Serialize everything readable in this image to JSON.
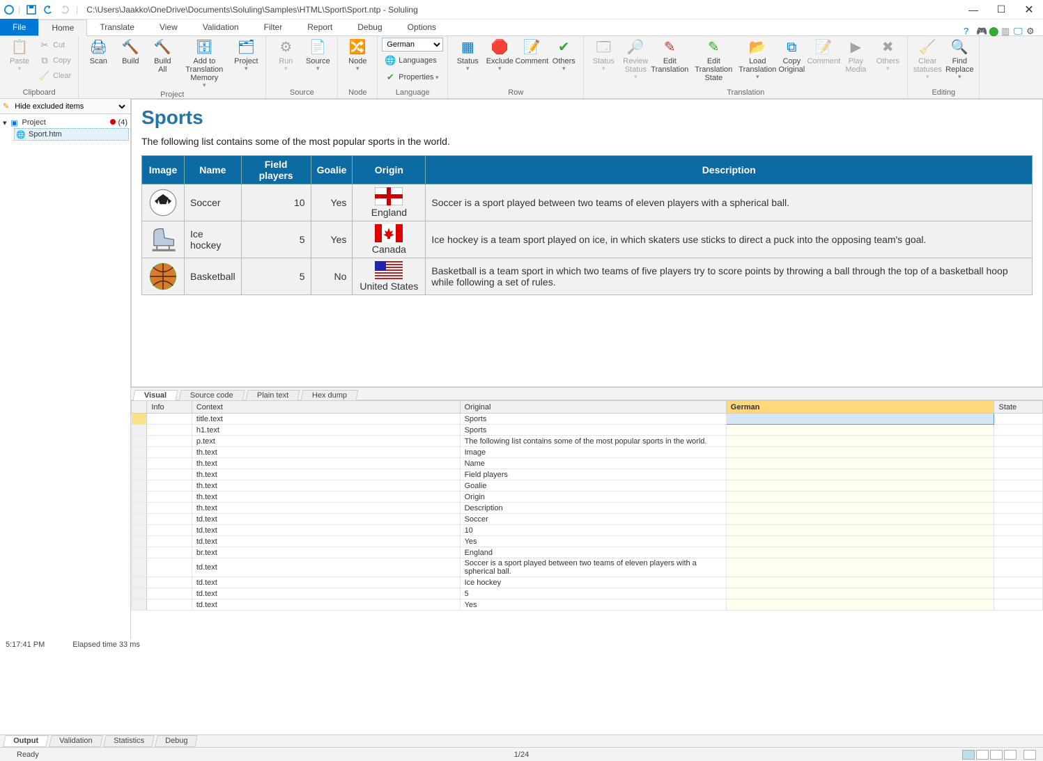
{
  "app": {
    "title_path": "C:\\Users\\Jaakko\\OneDrive\\Documents\\Soluling\\Samples\\HTML\\Sport\\Sport.ntp  -  Soluling"
  },
  "menutabs": {
    "file": "File",
    "items": [
      "Home",
      "Translate",
      "View",
      "Validation",
      "Filter",
      "Report",
      "Debug",
      "Options"
    ]
  },
  "ribbon": {
    "clipboard": {
      "title": "Clipboard",
      "paste": "Paste",
      "cut": "Cut",
      "copy": "Copy",
      "clear": "Clear"
    },
    "project": {
      "title": "Project",
      "scan": "Scan",
      "build": "Build",
      "buildall": "Build\nAll",
      "atm": "Add to Translation\nMemory",
      "project": "Project"
    },
    "source": {
      "title": "Source",
      "run": "Run",
      "source": "Source"
    },
    "node": {
      "title": "Node",
      "node": "Node"
    },
    "language": {
      "title": "Language",
      "selected": "German",
      "languages": "Languages",
      "properties": "Properties"
    },
    "row": {
      "title": "Row",
      "status": "Status",
      "exclude": "Exclude",
      "comment": "Comment",
      "others": "Others"
    },
    "translation": {
      "title": "Translation",
      "status": "Status",
      "review": "Review\nStatus",
      "edit": "Edit\nTranslation",
      "ets": "Edit Translation\nState",
      "load": "Load\nTranslation",
      "copyorig": "Copy\nOriginal",
      "comment": "Comment",
      "play": "Play\nMedia",
      "others": "Others"
    },
    "editing": {
      "title": "Editing",
      "clear": "Clear\nstatuses",
      "find": "Find\nReplace"
    }
  },
  "sidebar": {
    "filter": "Hide excluded items",
    "project_label": "Project",
    "badge": "(4)",
    "file_label": "Sport.htm"
  },
  "preview": {
    "h1": "Sports",
    "p": "The following list contains some of the most popular sports in the world.",
    "headers": [
      "Image",
      "Name",
      "Field players",
      "Goalie",
      "Origin",
      "Description"
    ],
    "rows": [
      {
        "name": "Soccer",
        "fp": "10",
        "goalie": "Yes",
        "origin": "England",
        "desc": "Soccer is a sport played between two teams of eleven players with a spherical ball."
      },
      {
        "name": "Ice hockey",
        "fp": "5",
        "goalie": "Yes",
        "origin": "Canada",
        "desc": "Ice hockey is a team sport played on ice, in which skaters use sticks to direct a puck into the opposing team's goal."
      },
      {
        "name": "Basketball",
        "fp": "5",
        "goalie": "No",
        "origin": "United States",
        "desc": "Basketball is a team sport in which two teams of five players try to score points by throwing a ball through the top of a basketball hoop while following a set of rules."
      }
    ]
  },
  "btabs": [
    "Visual",
    "Source code",
    "Plain text",
    "Hex dump"
  ],
  "grid": {
    "headers": {
      "info": "Info",
      "context": "Context",
      "original": "Original",
      "german": "German",
      "state": "State"
    },
    "rows": [
      {
        "context": "title.text",
        "original": "Sports"
      },
      {
        "context": "h1.text",
        "original": "Sports"
      },
      {
        "context": "p.text",
        "original": "The following list contains some of the most popular sports in the world."
      },
      {
        "context": "th.text",
        "original": "Image"
      },
      {
        "context": "th.text",
        "original": "Name"
      },
      {
        "context": "th.text",
        "original": "Field players"
      },
      {
        "context": "th.text",
        "original": "Goalie"
      },
      {
        "context": "th.text",
        "original": "Origin"
      },
      {
        "context": "th.text",
        "original": "Description"
      },
      {
        "context": "td.text",
        "original": "Soccer"
      },
      {
        "context": "td.text",
        "original": "10"
      },
      {
        "context": "td.text",
        "original": "Yes"
      },
      {
        "context": "br.text",
        "original": "England"
      },
      {
        "context": "td.text",
        "original": "Soccer is a sport played between two teams of eleven players with a spherical ball."
      },
      {
        "context": "td.text",
        "original": "Ice hockey"
      },
      {
        "context": "td.text",
        "original": "5"
      },
      {
        "context": "td.text",
        "original": "Yes"
      }
    ]
  },
  "timebar": {
    "time": "5:17:41 PM",
    "elapsed": "Elapsed time 33 ms"
  },
  "output_tabs": [
    "Output",
    "Validation",
    "Statistics",
    "Debug"
  ],
  "statusbar": {
    "ready": "Ready",
    "pos": "1/24"
  }
}
